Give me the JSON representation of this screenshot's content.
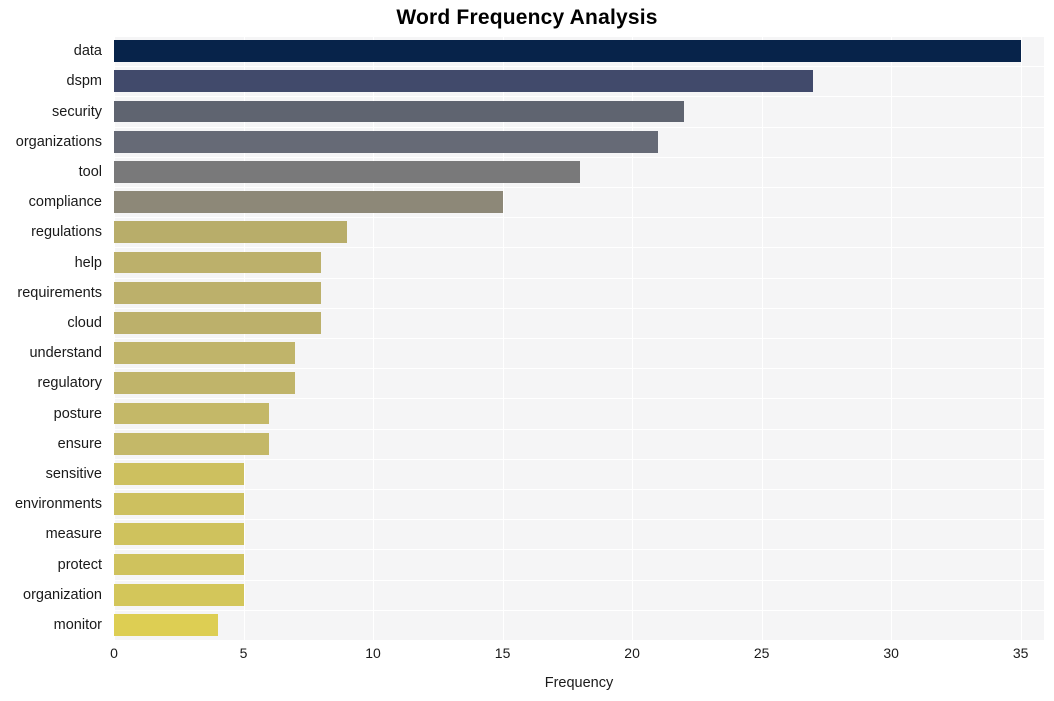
{
  "chart_data": {
    "type": "bar",
    "orientation": "horizontal",
    "title": "Word Frequency Analysis",
    "xlabel": "Frequency",
    "ylabel": "",
    "categories": [
      "data",
      "dspm",
      "security",
      "organizations",
      "tool",
      "compliance",
      "regulations",
      "help",
      "requirements",
      "cloud",
      "understand",
      "regulatory",
      "posture",
      "ensure",
      "sensitive",
      "environments",
      "measure",
      "protect",
      "organization",
      "monitor"
    ],
    "values": [
      35,
      27,
      22,
      21,
      18,
      15,
      9,
      8,
      8,
      8,
      7,
      7,
      6,
      6,
      5,
      5,
      5,
      5,
      5,
      4
    ],
    "bar_colors": [
      "#07234a",
      "#414a6b",
      "#5f6470",
      "#666a76",
      "#79797a",
      "#8d8878",
      "#b8ad6a",
      "#bcb06b",
      "#bcb06b",
      "#bcb06b",
      "#c0b46a",
      "#c0b46a",
      "#c4b868",
      "#c4b868",
      "#cdc05f",
      "#cdc05f",
      "#cfc25d",
      "#cfc25d",
      "#d3c65a",
      "#ddce53"
    ],
    "xlim": [
      0,
      35.9
    ],
    "x_ticks": [
      0,
      5,
      10,
      15,
      20,
      25,
      30,
      35
    ],
    "x_tick_labels": [
      "0",
      "5",
      "10",
      "15",
      "20",
      "25",
      "30",
      "35"
    ],
    "grid": true,
    "grid_axis": "both",
    "legend": null,
    "plot_background": "#f5f5f6",
    "figure_background": "#ffffff"
  }
}
